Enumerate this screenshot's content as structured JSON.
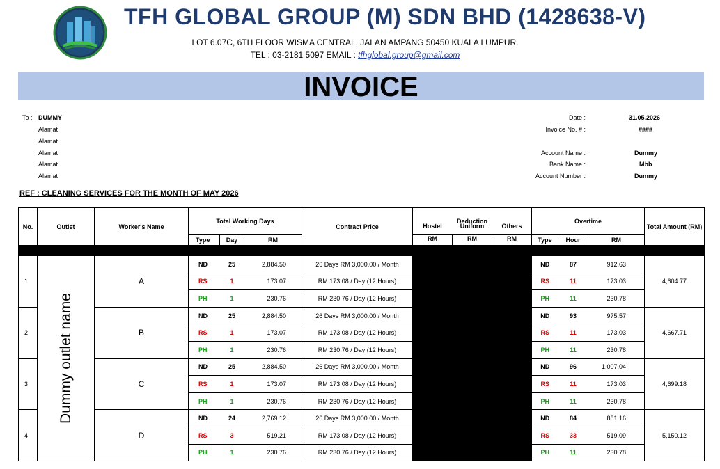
{
  "company": {
    "name": "TFH GLOBAL GROUP (M) SDN BHD (1428638-V)",
    "address": "LOT 6.07C, 6TH FLOOR WISMA CENTRAL, JALAN AMPANG 50450 KUALA LUMPUR.",
    "contact_prefix": "TEL : 03-2181 5097 EMAIL : ",
    "email": "tfhglobal.group@gmail.com"
  },
  "title": "INVOICE",
  "to": {
    "label": "To :",
    "name": "DUMMY",
    "address_lines": [
      "Alamat",
      "Alamat",
      "Alamat",
      "Alamat",
      "Alamat"
    ]
  },
  "meta": {
    "date_label": "Date :",
    "date": "31.05.2026",
    "invoice_no_label": "Invoice No. # :",
    "invoice_no": "####",
    "account_name_label": "Account Name :",
    "account_name": "Dummy",
    "bank_name_label": "Bank Name :",
    "bank_name": "Mbb",
    "account_number_label": "Account Number :",
    "account_number": "Dummy"
  },
  "ref": "REF : CLEANING SERVICES FOR THE MONTH OF MAY 2026",
  "table": {
    "headers": {
      "no": "No.",
      "outlet": "Outlet",
      "worker": "Worker's Name",
      "working_days": "Total Working Days",
      "contract": "Contract Price",
      "deduction": "Deduction",
      "overtime": "Overtime",
      "total": "Total Amount (RM)",
      "type": "Type",
      "day": "Day",
      "rm": "RM",
      "hostel": "Hostel",
      "uniform": "Uniform",
      "others": "Others",
      "hour": "Hour"
    },
    "outlet_name": "Dummy outlet name",
    "workers": [
      {
        "no": "1",
        "name": "A",
        "total": "4,604.77",
        "rows": [
          {
            "type": "ND",
            "day": "25",
            "rm": "2,884.50",
            "contract": "26 Days RM 3,000.00 / Month",
            "ot_type": "ND",
            "hour": "87",
            "ot_rm": "912.63"
          },
          {
            "type": "RS",
            "day": "1",
            "rm": "173.07",
            "contract": "RM 173.08 / Day (12 Hours)",
            "ot_type": "RS",
            "hour": "11",
            "ot_rm": "173.03"
          },
          {
            "type": "PH",
            "day": "1",
            "rm": "230.76",
            "contract": "RM 230.76 / Day (12 Hours)",
            "ot_type": "PH",
            "hour": "11",
            "ot_rm": "230.78"
          }
        ]
      },
      {
        "no": "2",
        "name": "B",
        "total": "4,667.71",
        "rows": [
          {
            "type": "ND",
            "day": "25",
            "rm": "2,884.50",
            "contract": "26 Days RM 3,000.00 / Month",
            "ot_type": "ND",
            "hour": "93",
            "ot_rm": "975.57"
          },
          {
            "type": "RS",
            "day": "1",
            "rm": "173.07",
            "contract": "RM 173.08 / Day (12 Hours)",
            "ot_type": "RS",
            "hour": "11",
            "ot_rm": "173.03"
          },
          {
            "type": "PH",
            "day": "1",
            "rm": "230.76",
            "contract": "RM 230.76 / Day (12 Hours)",
            "ot_type": "PH",
            "hour": "11",
            "ot_rm": "230.78"
          }
        ]
      },
      {
        "no": "3",
        "name": "C",
        "total": "4,699.18",
        "rows": [
          {
            "type": "ND",
            "day": "25",
            "rm": "2,884.50",
            "contract": "26 Days RM 3,000.00 / Month",
            "ot_type": "ND",
            "hour": "96",
            "ot_rm": "1,007.04"
          },
          {
            "type": "RS",
            "day": "1",
            "rm": "173.07",
            "contract": "RM 173.08 / Day (12 Hours)",
            "ot_type": "RS",
            "hour": "11",
            "ot_rm": "173.03"
          },
          {
            "type": "PH",
            "day": "1",
            "rm": "230.76",
            "contract": "RM 230.76 / Day (12 Hours)",
            "ot_type": "PH",
            "hour": "11",
            "ot_rm": "230.78"
          }
        ]
      },
      {
        "no": "4",
        "name": "D",
        "total": "5,150.12",
        "rows": [
          {
            "type": "ND",
            "day": "24",
            "rm": "2,769.12",
            "contract": "26 Days RM 3,000.00 / Month",
            "ot_type": "ND",
            "hour": "84",
            "ot_rm": "881.16"
          },
          {
            "type": "RS",
            "day": "3",
            "rm": "519.21",
            "contract": "RM 173.08 / Day (12 Hours)",
            "ot_type": "RS",
            "hour": "33",
            "ot_rm": "519.09"
          },
          {
            "type": "PH",
            "day": "1",
            "rm": "230.76",
            "contract": "RM 230.76 / Day (12 Hours)",
            "ot_type": "PH",
            "hour": "11",
            "ot_rm": "230.78"
          }
        ]
      }
    ]
  },
  "colors": {
    "company_name": "#1f3b6e",
    "banner": "#b4c6e7",
    "rs": "#e00000",
    "ph": "#12a012"
  }
}
